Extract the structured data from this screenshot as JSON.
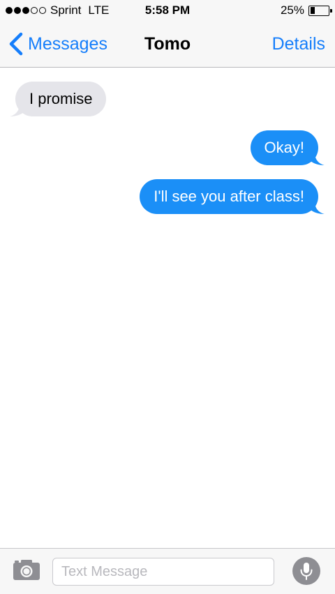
{
  "status_bar": {
    "signal_bars_filled": 3,
    "signal_bars_total": 5,
    "carrier": "Sprint",
    "network": "LTE",
    "time": "5:58 PM",
    "battery_percent_text": "25%",
    "battery_level": 0.25
  },
  "nav": {
    "back_label": "Messages",
    "title": "Tomo",
    "details_label": "Details",
    "back_icon": "chevron-left-icon"
  },
  "messages": [
    {
      "direction": "incoming",
      "text": "I promise"
    },
    {
      "direction": "outgoing",
      "text": "Okay!"
    },
    {
      "direction": "outgoing",
      "text": "I'll see you after class!"
    }
  ],
  "input_bar": {
    "placeholder": "Text Message",
    "value": "",
    "camera_icon": "camera-icon",
    "mic_icon": "microphone-icon"
  },
  "colors": {
    "accent": "#157efb",
    "outgoing_bubble": "#1b8ff7",
    "incoming_bubble": "#e5e5ea",
    "bar_background": "#f7f7f7",
    "icon_gray": "#8e8e93"
  }
}
